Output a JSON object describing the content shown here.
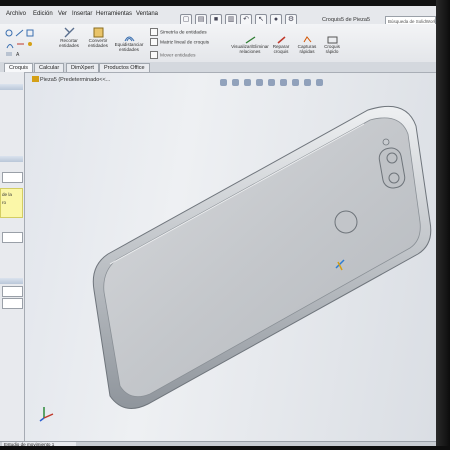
{
  "menu": [
    "Archivo",
    "Edición",
    "Ver",
    "Insertar",
    "Herramientas",
    "Ventana"
  ],
  "sketch_title": "Croquis5 de Pieza5",
  "search_placeholder": "Búsqueda de SolidWorks",
  "ribbon": {
    "recortar": "Recortar entidades",
    "convertir": "Convertir entidades",
    "equidistanciar": "Equidistanciar entidades",
    "simetria": "Simetría de entidades",
    "matriz": "Matriz lineal de croquis",
    "mover": "Mover entidades",
    "visualizar": "Visualizar/Eliminar relaciones",
    "reparar": "Reparar croquis",
    "capturas": "Capturas rápidas",
    "croquis_rapido": "Croquis rápido"
  },
  "tabs": [
    "Croquis",
    "Calcular",
    "DimXpert",
    "Productos Office"
  ],
  "left_panel": {
    "yellow_line1": "de la",
    "yellow_line2": "ro"
  },
  "view_title": "Pieza5 (Predeterminado<<...",
  "status": {
    "tab": "Estudio de movimiento 1"
  },
  "colors": {
    "accent": "#7a8fae",
    "body": "#c8cbcf",
    "highlight": "#fbf7a8"
  }
}
